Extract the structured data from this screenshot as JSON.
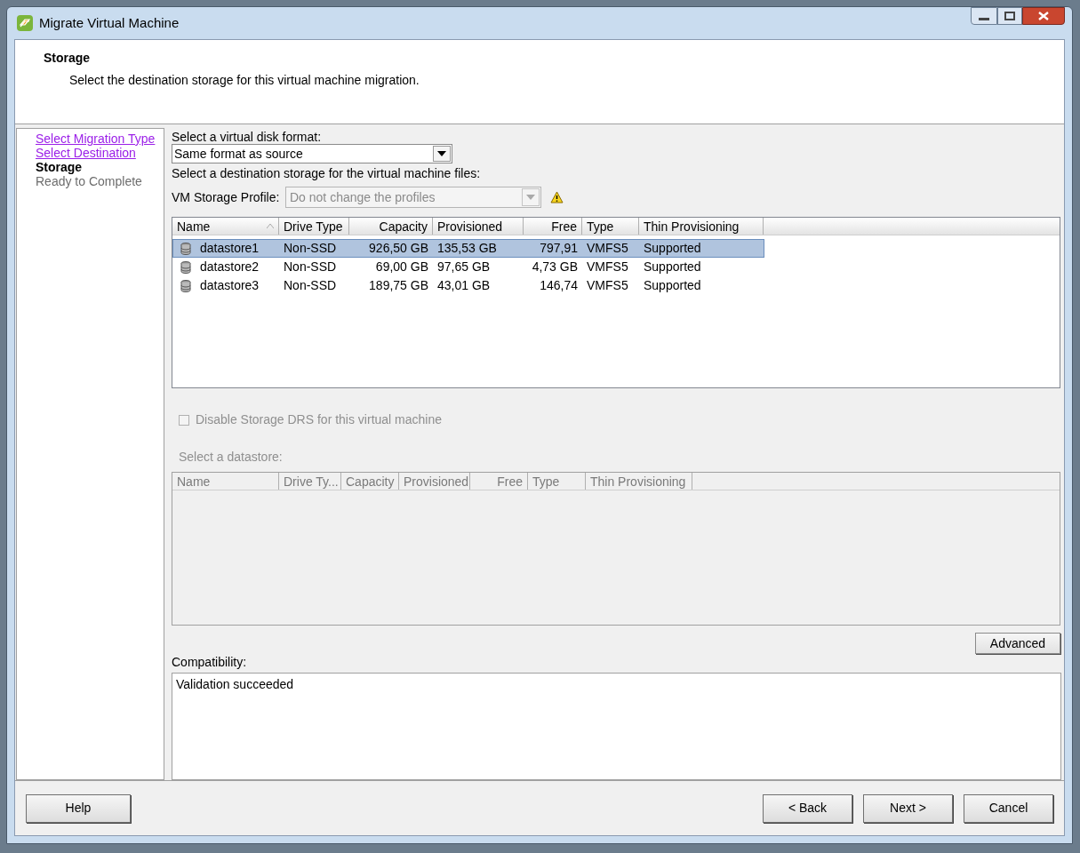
{
  "window": {
    "title": "Migrate Virtual Machine"
  },
  "header": {
    "title": "Storage",
    "subtitle": "Select the destination storage for this virtual machine migration."
  },
  "steps": [
    {
      "label": "Select Migration Type",
      "kind": "link",
      "selected": false
    },
    {
      "label": "Select Destination",
      "kind": "link",
      "selected": false
    },
    {
      "label": "Storage",
      "kind": "plain",
      "selected": true
    },
    {
      "label": "Ready to Complete",
      "kind": "pending",
      "selected": false
    }
  ],
  "disk_format": {
    "label": "Select a virtual disk format:",
    "value": "Same format as source"
  },
  "destination_label": "Select a destination storage for the virtual machine files:",
  "storage_profile": {
    "label": "VM Storage Profile:",
    "value": "Do not change the profiles",
    "disabled": true,
    "warning": true
  },
  "datastores": {
    "columns": [
      "Name",
      "Drive Type",
      "Capacity",
      "Provisioned",
      "Free",
      "Type",
      "Thin Provisioning"
    ],
    "rows": [
      {
        "cells": [
          "datastore1",
          "Non-SSD",
          "926,50 GB",
          "135,53 GB",
          "797,91",
          "VMFS5",
          "Supported"
        ],
        "selected": true
      },
      {
        "cells": [
          "datastore2",
          "Non-SSD",
          "69,00 GB",
          "97,65 GB",
          "4,73 GB",
          "VMFS5",
          "Supported"
        ],
        "selected": false
      },
      {
        "cells": [
          "datastore3",
          "Non-SSD",
          "189,75 GB",
          "43,01 GB",
          "146,74",
          "VMFS5",
          "Supported"
        ],
        "selected": false
      }
    ]
  },
  "disable_drs": {
    "label": "Disable Storage DRS for this virtual machine",
    "checked": false,
    "disabled": true
  },
  "select_datastore": {
    "label": "Select a datastore:",
    "disabled": true,
    "columns": [
      "Name",
      "Drive Ty...",
      "Capacity",
      "Provisioned",
      "Free",
      "Type",
      "Thin Provisioning"
    ]
  },
  "advanced_button": "Advanced",
  "compatibility": {
    "label": "Compatibility:",
    "text": "Validation succeeded"
  },
  "buttons": {
    "help": "Help",
    "back": "< Back",
    "next": "Next >",
    "cancel": "Cancel"
  }
}
